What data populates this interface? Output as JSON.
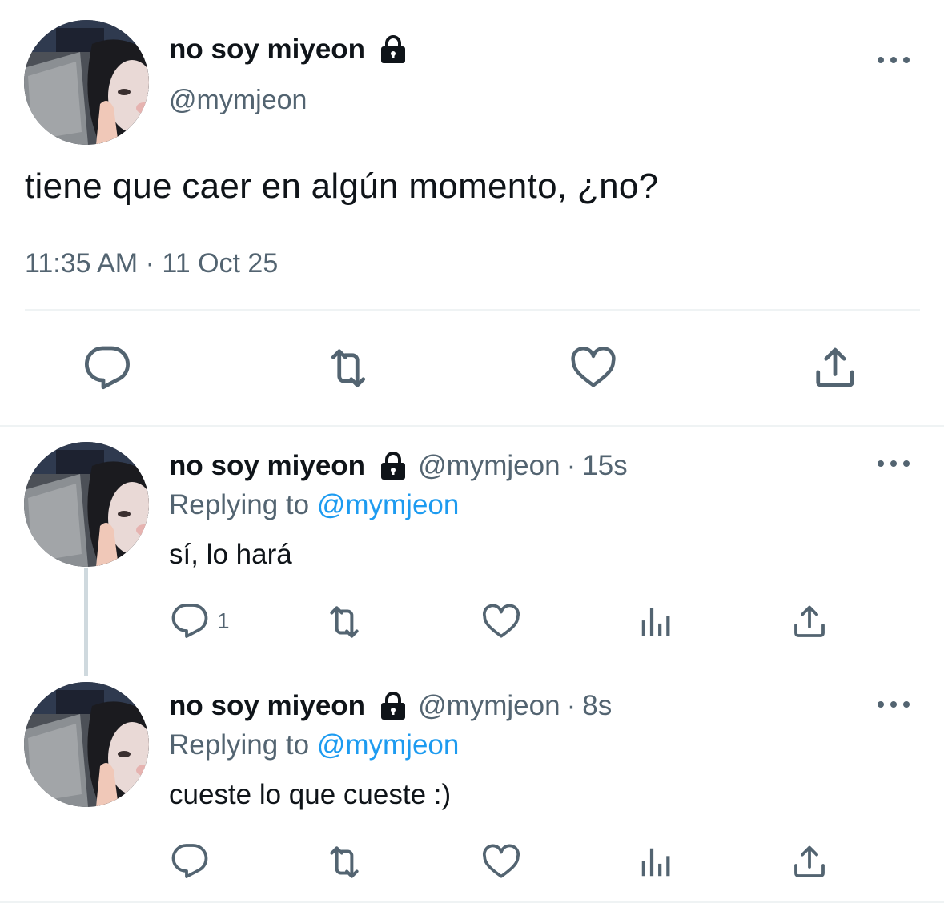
{
  "main_tweet": {
    "display_name": "no soy miyeon",
    "handle": "@mymjeon",
    "text": "tiene que caer en algún momento, ¿no?",
    "timestamp": "11:35 AM · 11 Oct 25",
    "icons": [
      "lock-icon",
      "more-icon",
      "reply-icon",
      "retweet-icon",
      "like-icon",
      "share-icon"
    ]
  },
  "replies": [
    {
      "display_name": "no soy miyeon",
      "handle": "@mymjeon",
      "separator": "·",
      "age": "15s",
      "replying_label": "Replying to",
      "replying_to": "@mymjeon",
      "text": "sí, lo hará",
      "reply_count": "1"
    },
    {
      "display_name": "no soy miyeon",
      "handle": "@mymjeon",
      "separator": "·",
      "age": "8s",
      "replying_label": "Replying to",
      "replying_to": "@mymjeon",
      "text": "cueste lo que cueste :)",
      "reply_count": ""
    }
  ],
  "colors": {
    "text": "#0f1419",
    "secondary": "#536471",
    "link": "#1d9bf0",
    "divider": "#eff3f4"
  }
}
